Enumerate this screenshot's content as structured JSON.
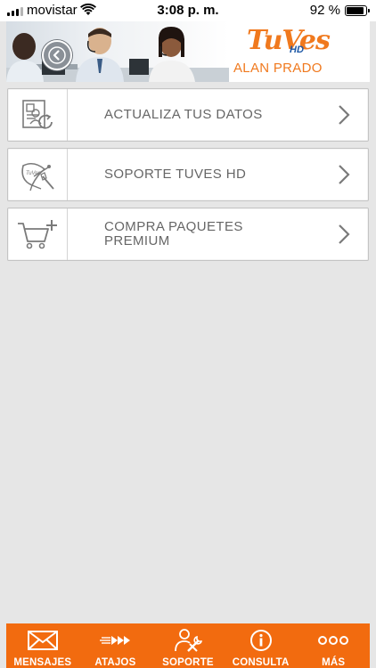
{
  "status_bar": {
    "carrier": "movistar",
    "time": "3:08 p. m.",
    "battery_percent": "92 %",
    "battery_level": 0.92
  },
  "header": {
    "logo_text": "TuVes",
    "logo_hd": "HD",
    "user_name": "ALAN PRADO",
    "brand_color": "#f0791e"
  },
  "menu": {
    "items": [
      {
        "label": "ACTUALIZA TUS DATOS",
        "icon": "profile-update-icon"
      },
      {
        "label": "SOPORTE TUVES HD",
        "icon": "satellite-dish-icon"
      },
      {
        "label": "COMPRA PAQUETES PREMIUM",
        "icon": "cart-add-icon"
      }
    ]
  },
  "tab_bar": {
    "color": "#f26b0f",
    "tabs": [
      {
        "label": "MENSAJES",
        "icon": "envelope-icon"
      },
      {
        "label": "ATAJOS",
        "icon": "fast-forward-icon"
      },
      {
        "label": "SOPORTE",
        "icon": "support-tools-icon"
      },
      {
        "label": "CONSULTA",
        "icon": "info-icon"
      },
      {
        "label": "MÁS",
        "icon": "more-dots-icon"
      }
    ]
  }
}
